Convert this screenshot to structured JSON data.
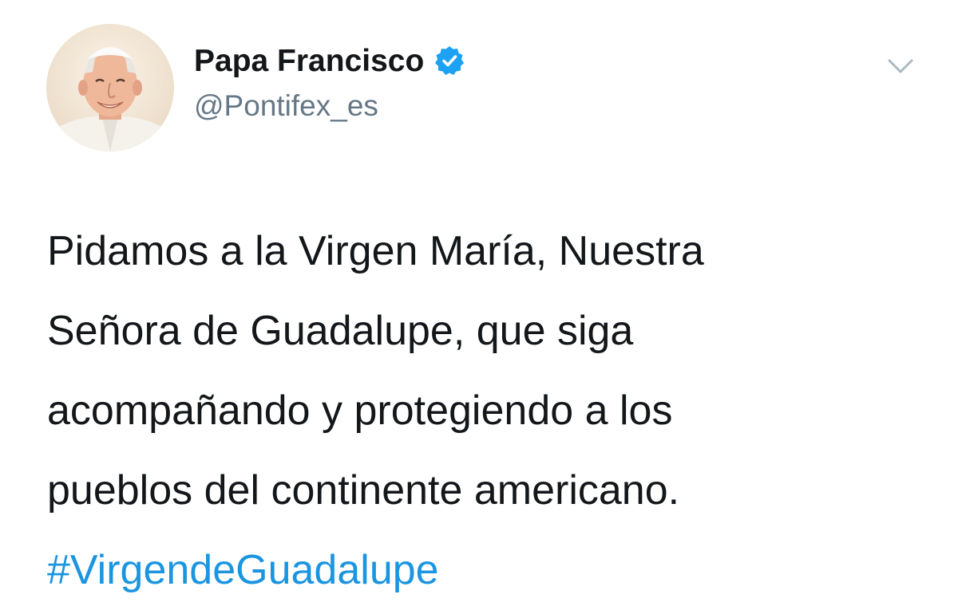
{
  "author": {
    "name": "Papa Francisco",
    "handle": "@Pontifex_es",
    "verified": true,
    "avatar_icon": "profile-photo"
  },
  "menu": {
    "icon": "chevron-down-icon"
  },
  "tweet": {
    "lines": [
      "Pidamos a la Virgen María, Nuestra",
      "Señora de Guadalupe, que siga",
      "acompañando y protegiendo a los",
      "pueblos del continente americano."
    ],
    "hashtag": "#VirgendeGuadalupe"
  },
  "colors": {
    "text": "#14171a",
    "handle": "#657786",
    "link": "#1b95e0",
    "verified": "#1da1f2",
    "chevron": "#aab8c2"
  }
}
